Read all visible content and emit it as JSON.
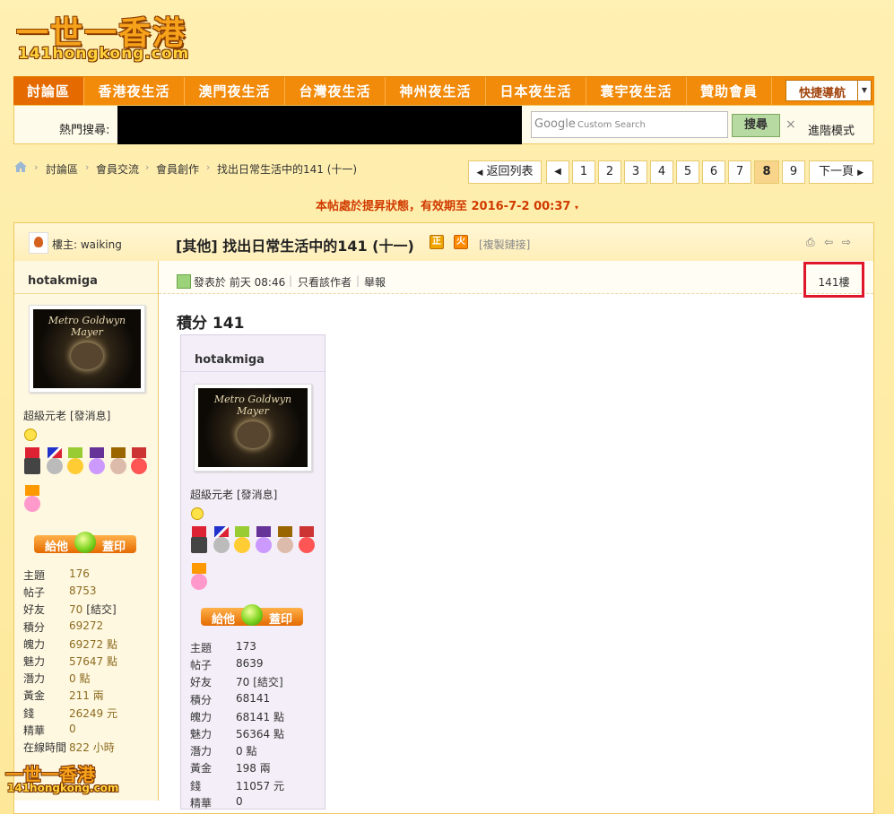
{
  "site": {
    "logo_main": "一世一香港",
    "logo_sub": "141hongkong.com"
  },
  "nav": {
    "items": [
      "討論區",
      "香港夜生活",
      "澳門夜生活",
      "台灣夜生活",
      "神州夜生活",
      "日本夜生活",
      "寰宇夜生活",
      "贊助會員"
    ],
    "quick_nav": "快捷導航"
  },
  "search": {
    "hot_label": "熱門搜尋:",
    "google_logo": "Google",
    "placeholder": "Custom Search",
    "button": "搜尋",
    "clear": "×",
    "advanced": "進階模式"
  },
  "breadcrumb": [
    "討論區",
    "會員交流",
    "會員創作",
    "找出日常生活中的141 (十一)"
  ],
  "pagination": {
    "back": "返回列表",
    "pages": [
      "1",
      "2",
      "3",
      "4",
      "5",
      "6",
      "7",
      "8",
      "9"
    ],
    "current": "8",
    "next": "下一頁"
  },
  "notice": "本帖處於提昇狀態，有效期至 2016-7-2 00:37",
  "thread": {
    "starter_label": "樓主: waiking",
    "title": "[其他] 找出日常生活中的141 (十一)",
    "badge_zheng": "正",
    "badge_fire": "火",
    "copy_link": "[複製鏈接]"
  },
  "post": {
    "author": "hotakmiga",
    "posted_on": "發表於 前天 08:46",
    "only_author": "只看該作者",
    "report": "舉報",
    "floor": "141樓"
  },
  "sidebar": {
    "avatar_text": "Metro Goldwyn Mayer",
    "rank": "超級元老",
    "send_msg": "[發消息]",
    "give_left": "給他",
    "give_right": "蓋印",
    "stats": [
      {
        "label": "主題",
        "value": "176"
      },
      {
        "label": "帖子",
        "value": "8753"
      },
      {
        "label": "好友",
        "value": "70",
        "extra": "[結交]"
      },
      {
        "label": "積分",
        "value": "69272"
      },
      {
        "label": "魄力",
        "value": "69272 點"
      },
      {
        "label": "魅力",
        "value": "57647 點"
      },
      {
        "label": "潛力",
        "value": "0 點"
      },
      {
        "label": "黃金",
        "value": "211 兩"
      },
      {
        "label": "錢",
        "value": "26249 元"
      },
      {
        "label": "精華",
        "value": "0"
      },
      {
        "label": "在線時間",
        "value": "822 小時"
      }
    ]
  },
  "content": {
    "score_title": "積分 141",
    "embedded": {
      "author": "hotakmiga",
      "avatar_text": "Metro Goldwyn Mayer",
      "rank": "超級元老",
      "send_msg": "[發消息]",
      "give_left": "給他",
      "give_right": "蓋印",
      "stats": [
        {
          "label": "主題",
          "value": "173"
        },
        {
          "label": "帖子",
          "value": "8639"
        },
        {
          "label": "好友",
          "value": "70",
          "extra": "[結交]"
        },
        {
          "label": "積分",
          "value": "68141"
        },
        {
          "label": "魄力",
          "value": "68141 點"
        },
        {
          "label": "魅力",
          "value": "56364 點"
        },
        {
          "label": "潛力",
          "value": "0 點"
        },
        {
          "label": "黃金",
          "value": "198 兩"
        },
        {
          "label": "錢",
          "value": "11057 元"
        },
        {
          "label": "精華",
          "value": "0"
        }
      ]
    }
  },
  "watermark": {
    "main": "一世一香港",
    "sub": "141hongkong.com"
  }
}
